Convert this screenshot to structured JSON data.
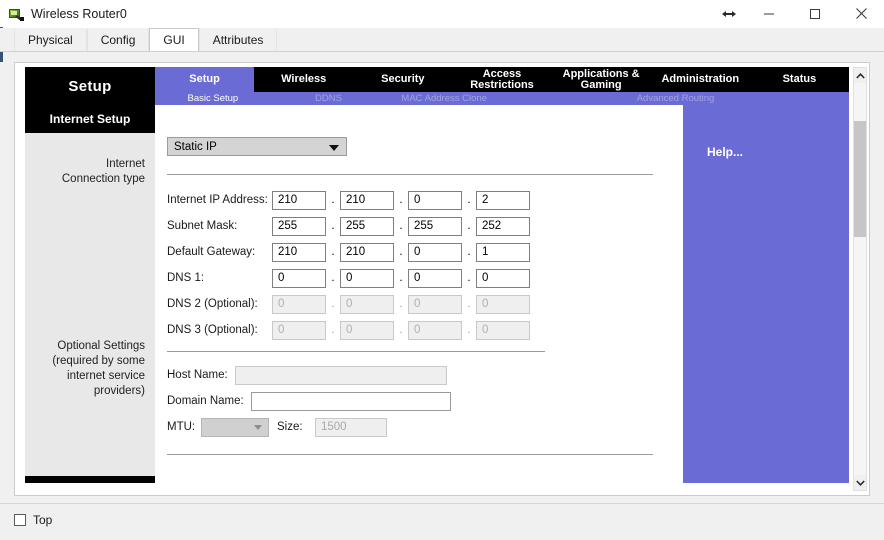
{
  "window": {
    "title": "Wireless Router0",
    "icon": "router-device-icon",
    "controls": {
      "resize": "resize-horizontal-icon",
      "minimize": "minimize-icon",
      "maximize": "maximize-icon",
      "close": "close-icon"
    }
  },
  "tabs": [
    {
      "label": "Physical",
      "active": false
    },
    {
      "label": "Config",
      "active": false
    },
    {
      "label": "GUI",
      "active": true
    },
    {
      "label": "Attributes",
      "active": false
    }
  ],
  "router": {
    "brand_title": "Setup",
    "nav": [
      {
        "label": "Setup",
        "active": true
      },
      {
        "label": "Wireless",
        "active": false
      },
      {
        "label": "Security",
        "active": false
      },
      {
        "label": "Access Restrictions",
        "active": false
      },
      {
        "label": "Applications & Gaming",
        "active": false
      },
      {
        "label": "Administration",
        "active": false
      },
      {
        "label": "Status",
        "active": false
      }
    ],
    "subnav": [
      {
        "label": "Basic Setup",
        "active": true
      },
      {
        "label": "DDNS",
        "active": false
      },
      {
        "label": "MAC Address Clone",
        "active": false
      },
      {
        "label": "Advanced Routing",
        "active": false
      }
    ],
    "sidebar": {
      "header": "Internet Setup",
      "connection_type_label": "Internet\nConnection type",
      "optional_label": "Optional Settings\n(required by some\ninternet service\nproviders)"
    },
    "connection_type": {
      "selected": "Static IP"
    },
    "ip_fields": [
      {
        "label": "Internet IP Address:",
        "octets": [
          "210",
          "210",
          "0",
          "2"
        ],
        "disabled": false
      },
      {
        "label": "Subnet Mask:",
        "octets": [
          "255",
          "255",
          "255",
          "252"
        ],
        "disabled": false
      },
      {
        "label": "Default Gateway:",
        "octets": [
          "210",
          "210",
          "0",
          "1"
        ],
        "disabled": false
      },
      {
        "label": "DNS 1:",
        "octets": [
          "0",
          "0",
          "0",
          "0"
        ],
        "disabled": false
      },
      {
        "label": "DNS 2 (Optional):",
        "octets": [
          "0",
          "0",
          "0",
          "0"
        ],
        "disabled": true
      },
      {
        "label": "DNS 3 (Optional):",
        "octets": [
          "0",
          "0",
          "0",
          "0"
        ],
        "disabled": true
      }
    ],
    "dot_separator": ".",
    "optional": {
      "host_name_label": "Host Name:",
      "host_name_value": "",
      "domain_name_label": "Domain Name:",
      "domain_name_value": "",
      "mtu_label": "MTU:",
      "mtu_value": "",
      "size_label": "Size:",
      "size_value": "1500"
    },
    "help_label": "Help...",
    "colors": {
      "accent_purple": "#6b6bd6",
      "banner_black": "#000000",
      "sidebar_gray": "#e8e8e8"
    }
  },
  "scrollbar": {
    "up_arrow": "chevron-up-icon",
    "down_arrow": "chevron-down-icon"
  },
  "bottom": {
    "top_checkbox_label": "Top",
    "top_checkbox_checked": false
  }
}
